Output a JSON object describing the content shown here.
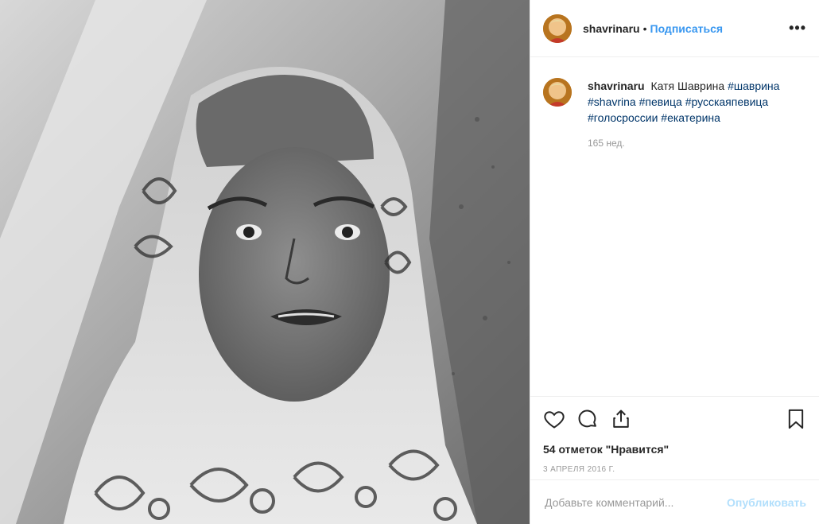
{
  "post": {
    "username": "shavrinaru",
    "separator": "•",
    "follow_label": "Подписаться",
    "more_label": "•••",
    "caption": {
      "username": "shavrinaru",
      "text": "Катя Шаврина",
      "hashtags": [
        "#шаврина",
        "#shavrina",
        "#певица",
        "#русскаяпевица",
        "#голосроссии",
        "#екатерина"
      ],
      "time_ago": "165 нед."
    },
    "likes_text": "54 отметок \"Нравится\"",
    "date": "3 апреля 2016 г.",
    "comment": {
      "placeholder": "Добавьте комментарий...",
      "publish_label": "Опубликовать"
    }
  },
  "icons": {
    "like": "heart-icon",
    "comment": "comment-icon",
    "share": "share-icon",
    "save": "bookmark-icon"
  },
  "colors": {
    "link": "#3897f0",
    "hashtag": "#003569",
    "muted": "#999999",
    "publish_disabled": "#b2dffc"
  }
}
